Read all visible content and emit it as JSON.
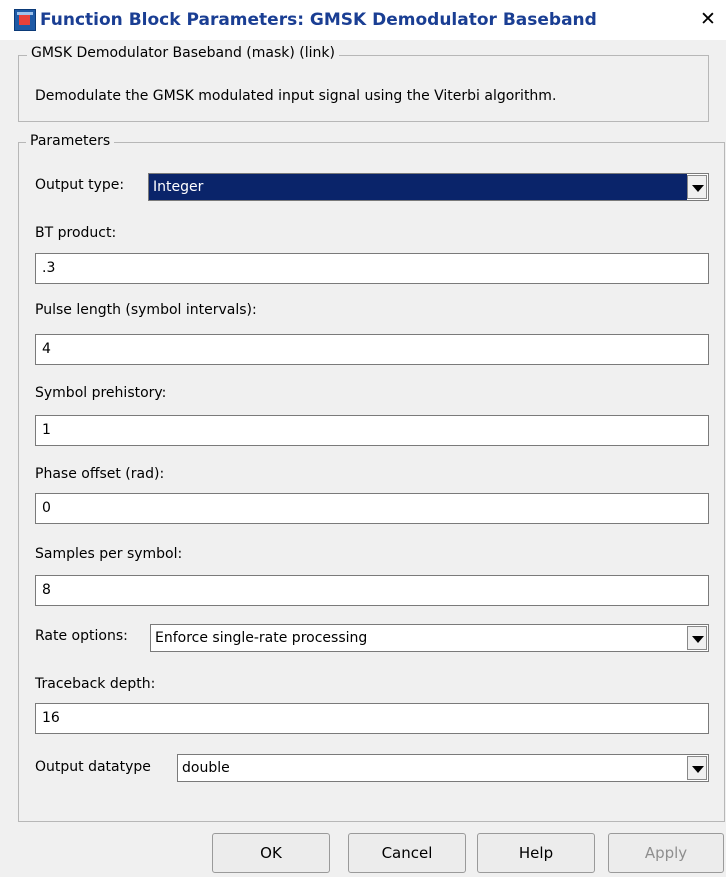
{
  "window": {
    "title": "Function Block Parameters: GMSK Demodulator Baseband",
    "close_glyph": "✕"
  },
  "mask": {
    "group_label": "GMSK Demodulator Baseband (mask) (link)",
    "description": "Demodulate the GMSK modulated input signal using the Viterbi algorithm."
  },
  "parameters": {
    "group_label": "Parameters",
    "output_type": {
      "label": "Output type:",
      "value": "Integer"
    },
    "bt_product": {
      "label": "BT product:",
      "value": ".3"
    },
    "pulse_length": {
      "label": "Pulse length (symbol intervals):",
      "value": "4"
    },
    "symbol_prehistory": {
      "label": "Symbol prehistory:",
      "value": "1"
    },
    "phase_offset": {
      "label": "Phase offset (rad):",
      "value": "0"
    },
    "samples_per_symbol": {
      "label": "Samples per symbol:",
      "value": "8"
    },
    "rate_options": {
      "label": "Rate options:",
      "value": "Enforce single-rate processing"
    },
    "traceback_depth": {
      "label": "Traceback depth:",
      "value": "16"
    },
    "output_datatype": {
      "label": "Output datatype",
      "value": "double"
    }
  },
  "buttons": {
    "ok": "OK",
    "cancel": "Cancel",
    "help": "Help",
    "apply": "Apply"
  }
}
